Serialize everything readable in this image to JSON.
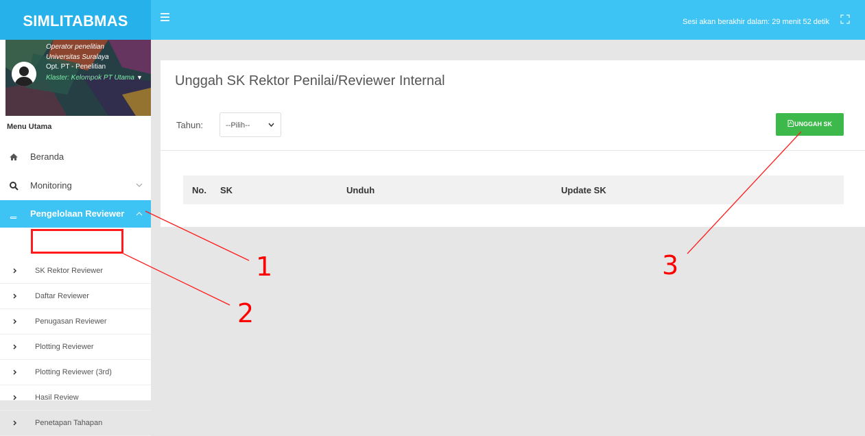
{
  "app": {
    "brand": "SIMLITABMAS"
  },
  "header": {
    "session_text": "Sesi akan berakhir dalam: 29 menit 52 detik"
  },
  "user": {
    "role": "Operator penelitian",
    "institution": "Universitas Suralaya",
    "name": "Opt. PT - Penelitian",
    "cluster": "Klaster: Kelompok PT Utama"
  },
  "sidebar": {
    "menu_heading": "Menu Utama",
    "items": [
      {
        "label": "Beranda",
        "icon": "home-icon"
      },
      {
        "label": "Monitoring",
        "icon": "search-icon"
      },
      {
        "label": "Pengelolaan Reviewer",
        "icon": "book-icon",
        "active": true
      }
    ],
    "subitems": [
      {
        "label": "SK Rektor Reviewer"
      },
      {
        "label": "Daftar Reviewer"
      },
      {
        "label": "Penugasan Reviewer"
      },
      {
        "label": "Plotting Reviewer"
      },
      {
        "label": "Plotting Reviewer (3rd)"
      },
      {
        "label": "Hasil Review"
      },
      {
        "label": "Penetapan Tahapan"
      }
    ]
  },
  "main": {
    "title": "Unggah SK Rektor Penilai/Reviewer Internal",
    "year_label": "Tahun:",
    "year_select": "--Pilih--",
    "upload_button": "UNGGAH SK",
    "table_headers": [
      "No.",
      "SK",
      "Unduh",
      "Update SK"
    ]
  },
  "annotations": {
    "labels": [
      "1",
      "2",
      "3"
    ],
    "color": "#ff0000"
  },
  "colors": {
    "topbar": "#3ec3f5",
    "brand_bg": "#26b1ea",
    "active_menu": "#3ec3f5",
    "button_green": "#3cb94a"
  }
}
